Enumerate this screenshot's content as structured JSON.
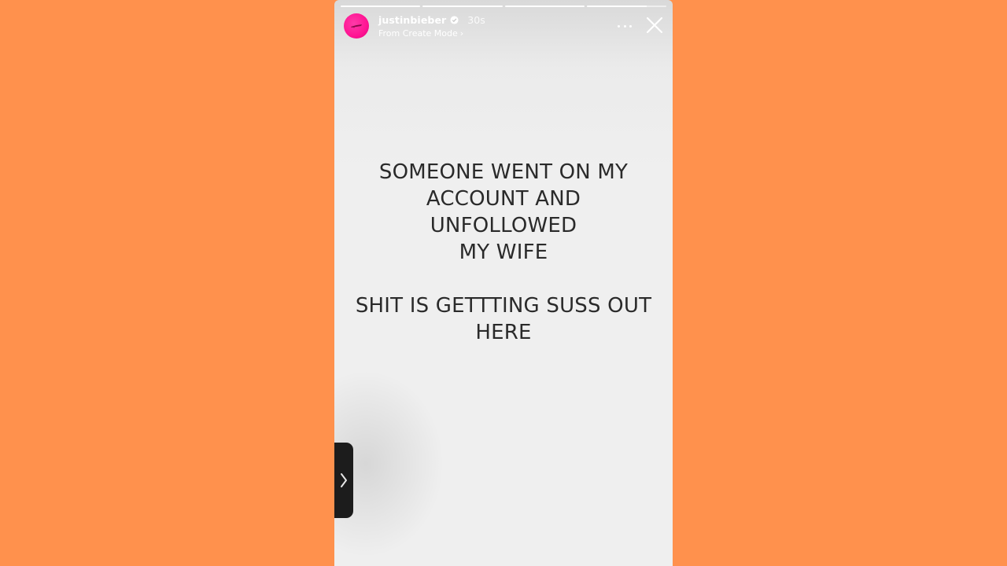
{
  "story": {
    "progress_segments": [
      1,
      1,
      1,
      0.75
    ],
    "username": "justinbieber",
    "verified": true,
    "time_ago": "30s",
    "subtitle": "From Create Mode",
    "subtitle_chevron": "›",
    "icons": {
      "avatar": "avatar-pink",
      "verified": "verified-badge-icon",
      "more": "more-dots-icon",
      "close": "close-icon",
      "side_tab": "chevron-right-icon"
    },
    "text_block_1": [
      "SOMEONE WENT ON MY",
      "ACCOUNT AND UNFOLLOWED",
      "MY WIFE"
    ],
    "text_block_2": [
      "SHIT IS GETTTING SUSS OUT",
      "HERE"
    ]
  },
  "colors": {
    "background": "#FF914D",
    "story_bg": "#EFEFEF",
    "text": "#2A2A2A",
    "avatar": "#FF1493"
  }
}
